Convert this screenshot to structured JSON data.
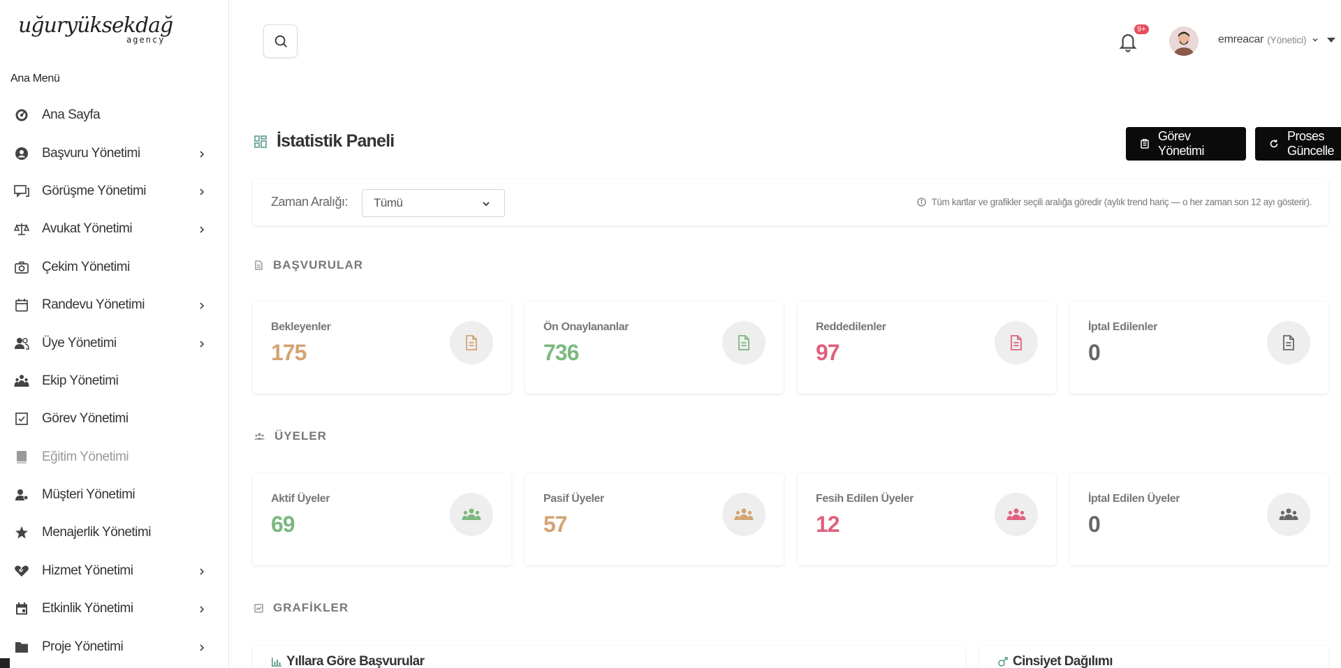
{
  "brand": {
    "logo_text": "uğuryüksekdağ",
    "logo_sub": "agency"
  },
  "sidebar": {
    "section_title": "Ana Menü",
    "items": [
      {
        "label": "Ana Sayfa",
        "icon": "dashboard-icon",
        "has_children": false
      },
      {
        "label": "Başvuru Yönetimi",
        "icon": "user-circle-icon",
        "has_children": true
      },
      {
        "label": "Görüşme Yönetimi",
        "icon": "chat-icon",
        "has_children": true
      },
      {
        "label": "Avukat Yönetimi",
        "icon": "scale-icon",
        "has_children": true
      },
      {
        "label": "Çekim Yönetimi",
        "icon": "camera-icon",
        "has_children": false
      },
      {
        "label": "Randevu Yönetimi",
        "icon": "calendar-icon",
        "has_children": true
      },
      {
        "label": "Üye Yönetimi",
        "icon": "users-icon",
        "has_children": true
      },
      {
        "label": "Ekip Yönetimi",
        "icon": "team-icon",
        "has_children": false
      },
      {
        "label": "Görev Yönetimi",
        "icon": "checkbox-icon",
        "has_children": false
      },
      {
        "label": "Eğitim Yönetimi",
        "icon": "book-icon",
        "has_children": false,
        "muted": true
      },
      {
        "label": "Müşteri Yönetimi",
        "icon": "customer-icon",
        "has_children": false
      },
      {
        "label": "Menajerlik Yönetimi",
        "icon": "star-icon",
        "has_children": false
      },
      {
        "label": "Hizmet Yönetimi",
        "icon": "handshake-icon",
        "has_children": true
      },
      {
        "label": "Etkinlik Yönetimi",
        "icon": "event-icon",
        "has_children": true
      },
      {
        "label": "Proje Yönetimi",
        "icon": "folder-icon",
        "has_children": true
      }
    ]
  },
  "topbar": {
    "notification_count": "9+",
    "username": "emreacar",
    "role": "(Yönetici)"
  },
  "page": {
    "title": "İstatistik Paneli",
    "task_button": "Görev Yönetimi",
    "process_button": "Proses Güncelle"
  },
  "filter": {
    "label": "Zaman Aralığı:",
    "selected": "Tümü",
    "note": "Tüm kartlar ve grafikler seçili aralığa göredir (aylık trend hariç — o her zaman son 12 ayı gösterir)."
  },
  "sections": {
    "applications": "BAŞVURULAR",
    "members": "ÜYELER",
    "charts": "GRAFİKLER"
  },
  "application_cards": [
    {
      "label": "Bekleyenler",
      "value": "175",
      "color": "#d4a373"
    },
    {
      "label": "Ön Onaylananlar",
      "value": "736",
      "color": "#7cb87f"
    },
    {
      "label": "Reddedilenler",
      "value": "97",
      "color": "#e0607e"
    },
    {
      "label": "İptal Edilenler",
      "value": "0",
      "color": "#666666"
    }
  ],
  "member_cards": [
    {
      "label": "Aktif Üyeler",
      "value": "69",
      "color": "#7cb87f"
    },
    {
      "label": "Pasif Üyeler",
      "value": "57",
      "color": "#d4a373"
    },
    {
      "label": "Fesih Edilen Üyeler",
      "value": "12",
      "color": "#e0607e"
    },
    {
      "label": "İptal Edilen Üyeler",
      "value": "0",
      "color": "#666666"
    }
  ],
  "charts": {
    "yearly_title": "Yıllara Göre Başvurular",
    "gender_title": "Cinsiyet Dağılımı"
  }
}
